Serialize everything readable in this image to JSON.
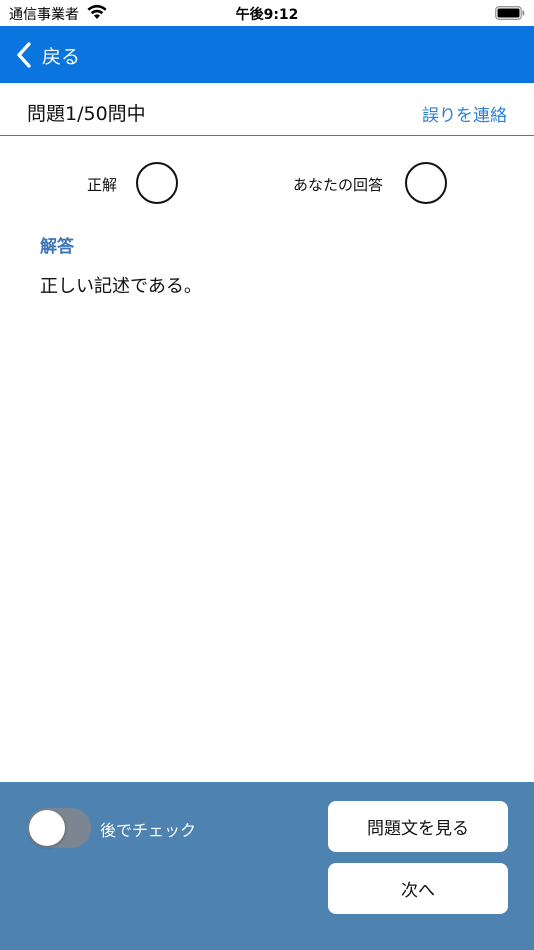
{
  "status_bar": {
    "carrier": "通信事業者",
    "time": "午後9:12"
  },
  "nav": {
    "back_label": "戻る"
  },
  "header": {
    "progress": "問題1/50問中",
    "report_link": "誤りを連絡"
  },
  "result": {
    "correct_label": "正解",
    "your_answer_label": "あなたの回答"
  },
  "answer": {
    "title": "解答",
    "text": "正しい記述である。"
  },
  "bottom": {
    "check_later_label": "後でチェック",
    "view_question_label": "問題文を見る",
    "next_label": "次へ"
  },
  "colors": {
    "nav_blue": "#0a74df",
    "accent_blue": "#2b7fd6",
    "panel_blue": "#4e82b1"
  },
  "icons": [
    "wifi-icon",
    "battery-icon",
    "chevron-left-icon",
    "circle-mark-icon"
  ]
}
